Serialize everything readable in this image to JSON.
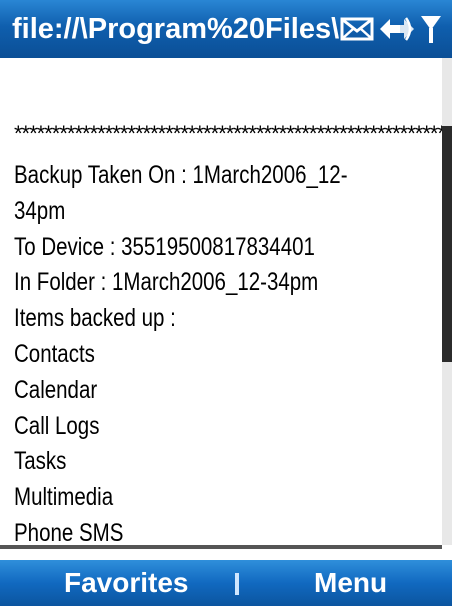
{
  "titlebar": {
    "title": "file://\\Program%20Files\\"
  },
  "status_icons": [
    "mail-icon",
    "connectivity-icon",
    "signal-icon"
  ],
  "content": {
    "separator": "**************************************************************",
    "lines": [
      "Backup Taken On : 1March2006_12-",
      "34pm",
      "To Device : 35519500817834401",
      "In Folder : 1March2006_12-34pm",
      "Items backed up :",
      "Contacts",
      "Calendar",
      "Call Logs",
      "Tasks",
      "Multimedia",
      "Phone SMS"
    ]
  },
  "softkeys": {
    "left": "Favorites",
    "right": "Menu"
  },
  "colors": {
    "bar_blue": "#0f5fae",
    "text": "#000000",
    "softkey_text": "#ffffff"
  }
}
